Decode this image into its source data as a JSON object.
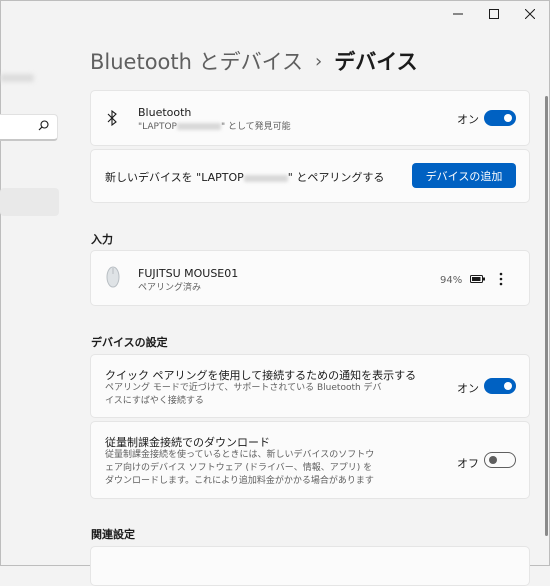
{
  "window": {
    "minimize": "—",
    "maximize": "☐",
    "close": "✕"
  },
  "breadcrumb": {
    "parent": "Bluetooth とデバイス",
    "separator": "›",
    "current": "デバイス"
  },
  "bluetooth": {
    "title": "Bluetooth",
    "discoverable_prefix": "\"LAPTOP",
    "discoverable_suffix": "\" として発見可能",
    "toggle_label": "オン",
    "toggle_state": "on"
  },
  "pairing": {
    "text_prefix": "新しいデバイスを \"LAPTOP",
    "text_suffix": "\" とペアリングする",
    "add_button": "デバイスの追加"
  },
  "input_section": {
    "title": "入力",
    "device": {
      "name": "FUJITSU MOUSE01",
      "status": "ペアリング済み",
      "battery": "94%",
      "battery_level": 0.94
    }
  },
  "device_settings": {
    "title": "デバイスの設定",
    "quick_pair": {
      "title": "クイック ペアリングを使用して接続するための通知を表示する",
      "desc": "ペアリング モードで近づけて、サポートされている Bluetooth デバイスにすばやく接続する",
      "toggle_label": "オン",
      "toggle_state": "on"
    },
    "metered": {
      "title": "従量制課金接続でのダウンロード",
      "desc": "従量制課金接続を使っているときには、新しいデバイスのソフトウェア向けのデバイス ソフトウェア (ドライバー、情報、アプリ) をダウンロードします。これにより追加料金がかかる場合があります",
      "toggle_label": "オフ",
      "toggle_state": "off"
    }
  },
  "related": {
    "title": "関連設定"
  },
  "colors": {
    "accent": "#0061c2",
    "background": "#f3f3f3",
    "card": "#fbfbfb"
  }
}
